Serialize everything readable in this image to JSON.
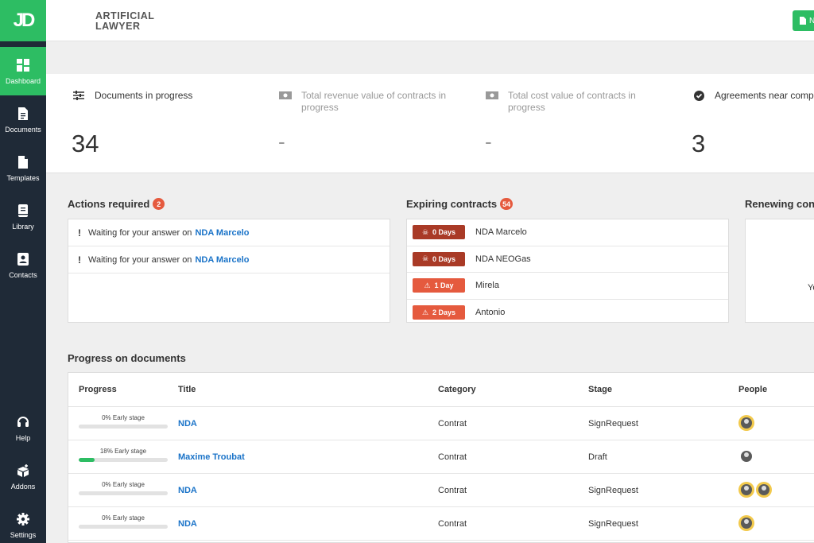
{
  "brand": {
    "logo": "JD",
    "name_line1": "ARTIFICIAL",
    "name_line2": "LAWYER"
  },
  "topbar": {
    "new_button_label": "N"
  },
  "sidebar": {
    "items": [
      {
        "label": "Dashboard",
        "icon": "dashboard-icon",
        "active": true
      },
      {
        "label": "Documents",
        "icon": "document-icon"
      },
      {
        "label": "Templates",
        "icon": "template-icon"
      },
      {
        "label": "Library",
        "icon": "library-icon"
      },
      {
        "label": "Contacts",
        "icon": "contacts-icon"
      }
    ],
    "bottom_items": [
      {
        "label": "Help",
        "icon": "headset-icon"
      },
      {
        "label": "Addons",
        "icon": "addons-icon"
      },
      {
        "label": "Settings",
        "icon": "gear-icon"
      }
    ]
  },
  "stats": [
    {
      "label": "Documents in progress",
      "value": "34",
      "icon": "sliders-icon"
    },
    {
      "label": "Total revenue value of contracts in progress",
      "value": "-",
      "icon": "money-icon"
    },
    {
      "label": "Total cost value of contracts in progress",
      "value": "-",
      "icon": "money-icon"
    },
    {
      "label": "Agreements near complet",
      "value": "3",
      "icon": "check-circle-icon"
    }
  ],
  "actions": {
    "title": "Actions required",
    "count": "2",
    "items": [
      {
        "text": "Waiting for your answer on",
        "link": "NDA Marcelo"
      },
      {
        "text": "Waiting for your answer on",
        "link": "NDA Marcelo"
      }
    ]
  },
  "expiring": {
    "title": "Expiring contracts",
    "count": "54",
    "items": [
      {
        "days": "0 Days",
        "name": "NDA Marcelo",
        "level": "expired"
      },
      {
        "days": "0 Days",
        "name": "NDA NEOGas",
        "level": "expired"
      },
      {
        "days": "1 Day",
        "name": "Mirela",
        "level": "warning"
      },
      {
        "days": "2 Days",
        "name": "Antonio",
        "level": "warning"
      }
    ]
  },
  "renewing": {
    "title": "Renewing con",
    "partial_text": "Yo"
  },
  "progress": {
    "title": "Progress on documents",
    "headers": {
      "progress": "Progress",
      "title": "Title",
      "category": "Category",
      "stage": "Stage",
      "people": "People"
    },
    "rows": [
      {
        "progress_label": "0% Early stage",
        "progress": 0,
        "title": "NDA",
        "category": "Contrat",
        "stage": "SignRequest",
        "people": 1
      },
      {
        "progress_label": "18% Early stage",
        "progress": 18,
        "title": "Maxime Troubat",
        "category": "Contrat",
        "stage": "Draft",
        "people": 1,
        "plain_avatar": true
      },
      {
        "progress_label": "0% Early stage",
        "progress": 0,
        "title": "NDA",
        "category": "Contrat",
        "stage": "SignRequest",
        "people": 2
      },
      {
        "progress_label": "0% Early stage",
        "progress": 0,
        "title": "NDA",
        "category": "Contrat",
        "stage": "SignRequest",
        "people": 1
      }
    ]
  },
  "colors": {
    "accent": "#2dbd63",
    "sidebar": "#1f2a37",
    "link": "#1a73c8",
    "alert": "#e55a3e",
    "alert_dark": "#a93a26"
  }
}
